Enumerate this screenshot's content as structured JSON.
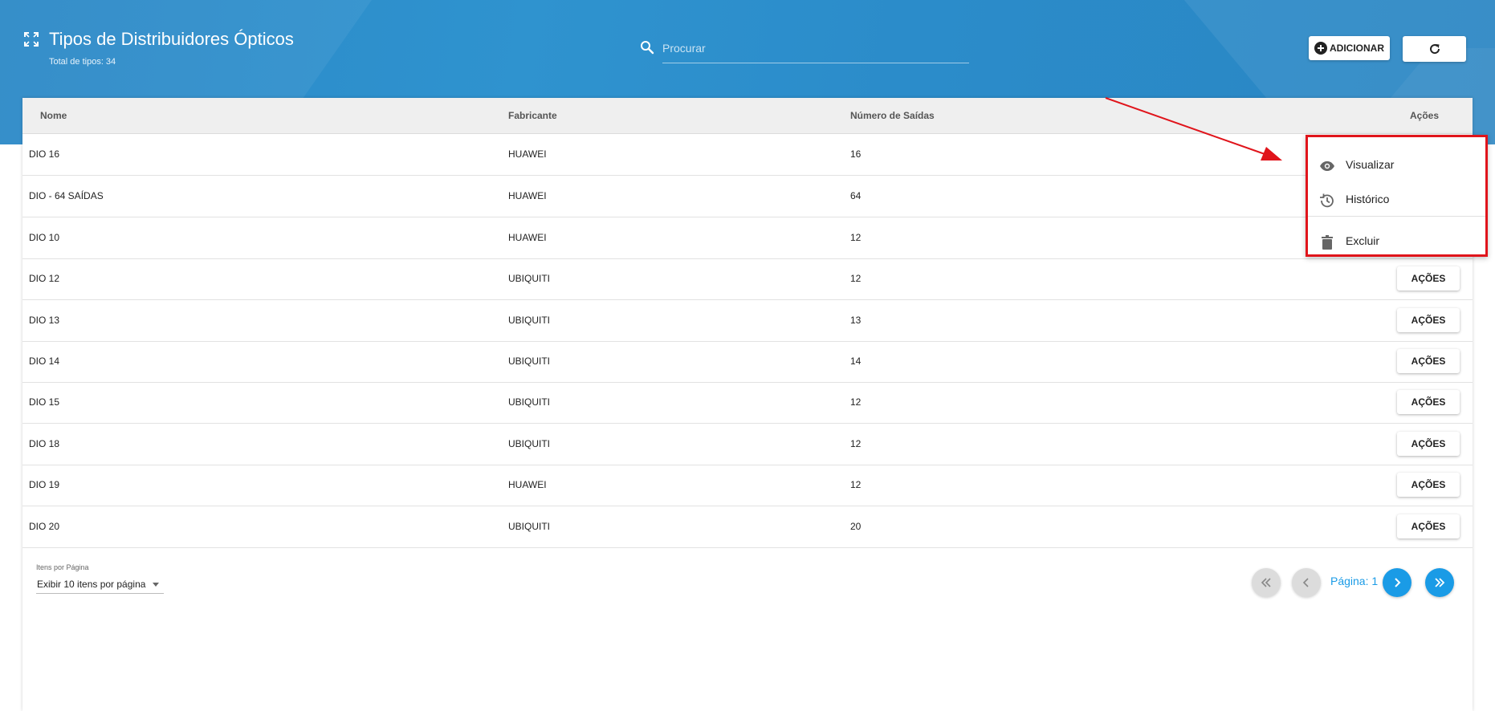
{
  "header": {
    "title": "Tipos de Distribuidores Ópticos",
    "subtitle": "Total de tipos: 34",
    "title_icon": "fullscreen-icon",
    "search": {
      "placeholder": "Procurar",
      "value": ""
    },
    "add_label": "ADICIONAR",
    "add_icon": "plus-circle-icon",
    "refresh_icon": "refresh-icon"
  },
  "table": {
    "columns": [
      "Nome",
      "Fabricante",
      "Número de Saídas",
      "Ações"
    ],
    "rows": [
      {
        "name": "DIO 16",
        "maker": "HUAWEI",
        "outputs": "16"
      },
      {
        "name": "DIO - 64 SAÍDAS",
        "maker": "HUAWEI",
        "outputs": "64"
      },
      {
        "name": "DIO 10",
        "maker": "HUAWEI",
        "outputs": "12"
      },
      {
        "name": "DIO 12",
        "maker": "UBIQUITI",
        "outputs": "12"
      },
      {
        "name": "DIO 13",
        "maker": "UBIQUITI",
        "outputs": "13"
      },
      {
        "name": "DIO 14",
        "maker": "UBIQUITI",
        "outputs": "14"
      },
      {
        "name": "DIO 15",
        "maker": "UBIQUITI",
        "outputs": "12"
      },
      {
        "name": "DIO 18",
        "maker": "UBIQUITI",
        "outputs": "12"
      },
      {
        "name": "DIO 19",
        "maker": "HUAWEI",
        "outputs": "12"
      },
      {
        "name": "DIO 20",
        "maker": "UBIQUITI",
        "outputs": "20"
      }
    ],
    "actions_label": "AÇÕES"
  },
  "footer": {
    "items_per_page_label": "Itens por Página",
    "items_per_page_value": "Exibir 10 itens por página",
    "page_label": "Página: 1"
  },
  "menu": {
    "items": [
      {
        "label": "Visualizar",
        "icon": "eye-icon"
      },
      {
        "label": "Histórico",
        "icon": "history-icon"
      },
      {
        "label": "Excluir",
        "icon": "trash-icon"
      }
    ]
  },
  "colors": {
    "header_blue": "#2b8cca",
    "accent_blue": "#1a9be6",
    "highlight_red": "#e0141b"
  }
}
